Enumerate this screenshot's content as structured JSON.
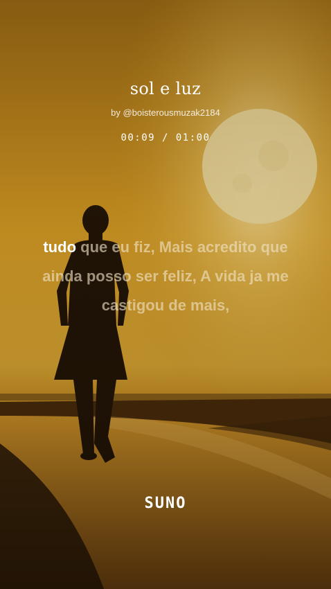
{
  "song": {
    "title": "sol e luz",
    "byline": "by @boisterousmuzak2184",
    "time": "00:09 / 01:00"
  },
  "lyrics": {
    "active_word": "tudo",
    "rest": " que eu fiz, Mais acredito que ainda posso ser feliz, A vida ja me castigou de mais,"
  },
  "brand": {
    "logo_text": "SUNO"
  },
  "colors": {
    "sky": "#d9a224",
    "sun": "#f6e8b0",
    "silhouette": "#1e1206"
  }
}
